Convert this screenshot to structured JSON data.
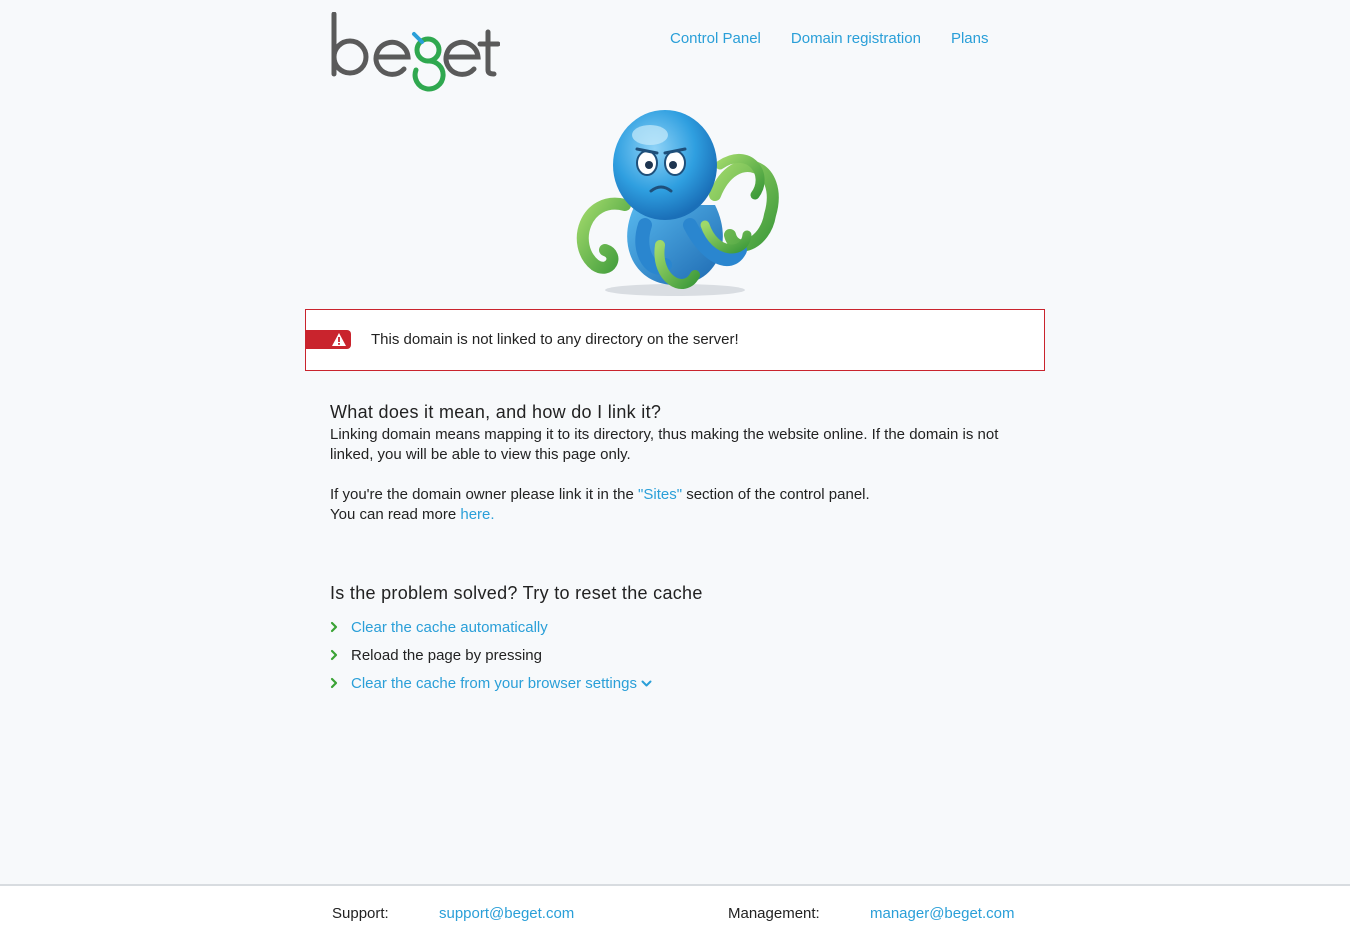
{
  "header": {
    "logo_text": "beget",
    "nav": [
      {
        "label": "Control Panel"
      },
      {
        "label": "Domain registration"
      },
      {
        "label": "Plans"
      }
    ]
  },
  "alert": {
    "message": "This domain is not linked to any directory on the server!"
  },
  "section1": {
    "heading": "What does it mean, and how do I link it?",
    "paragraph": "Linking domain means mapping it to its directory, thus making the website online. If the domain is not linked, you will be able to view this page only.",
    "owner_prefix": "If you're the domain owner please link it in the ",
    "sites_link": "\"Sites\"",
    "owner_suffix": " section of the control panel.",
    "read_more_prefix": "You can read more ",
    "here_link": "here."
  },
  "section2": {
    "heading": "Is the problem solved? Try to reset the cache",
    "items": [
      {
        "label": "Clear the cache automatically"
      },
      {
        "label": "Reload the page by pressing"
      },
      {
        "label": "Clear the cache from your browser settings"
      }
    ]
  },
  "footer": {
    "support_label": "Support:",
    "support_email": "support@beget.com",
    "management_label": "Management:",
    "management_email": "manager@beget.com"
  },
  "colors": {
    "link": "#2a9fd8",
    "alert_red": "#c9242d",
    "logo_gray": "#5a5a5a",
    "logo_green": "#2fa84f",
    "chevron_green": "#3aa335"
  }
}
